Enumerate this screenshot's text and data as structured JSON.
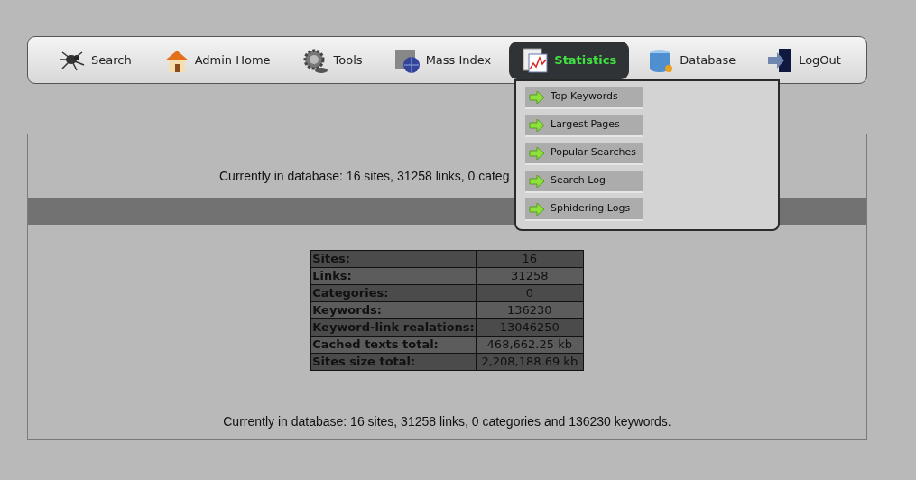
{
  "nav": [
    {
      "label": "Search",
      "selected": false
    },
    {
      "label": "Admin Home",
      "selected": false
    },
    {
      "label": "Tools",
      "selected": false
    },
    {
      "label": "Mass Index",
      "selected": false
    },
    {
      "label": "Statistics",
      "selected": true
    },
    {
      "label": "Database",
      "selected": false
    },
    {
      "label": "LogOut",
      "selected": false
    }
  ],
  "dropdown": [
    "Top Keywords",
    "Largest Pages",
    "Popular Searches",
    "Search Log",
    "Sphidering Logs"
  ],
  "summary_top": "Currently in database: 16 sites, 31258 links, 0 categ",
  "stats": [
    {
      "label": "Sites:",
      "value": "16"
    },
    {
      "label": "Links:",
      "value": "31258"
    },
    {
      "label": "Categories:",
      "value": "0"
    },
    {
      "label": "Keywords:",
      "value": "136230"
    },
    {
      "label": "Keyword-link realations:",
      "value": "13046250"
    },
    {
      "label": "Cached texts total:",
      "value": "468,662.25 kb"
    },
    {
      "label": "Sites size total:",
      "value": "2,208,188.69 kb"
    }
  ],
  "summary_bottom": "Currently in database: 16 sites, 31258 links, 0 categories and 136230 keywords."
}
